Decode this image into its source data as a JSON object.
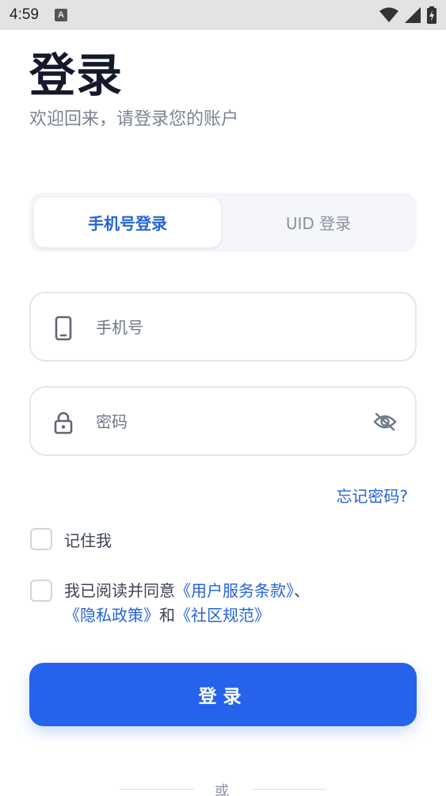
{
  "status_bar": {
    "time": "4:59",
    "notification_letter": "A"
  },
  "header": {
    "title": "登录",
    "subtitle": "欢迎回来，请登录您的账户"
  },
  "tabs": [
    {
      "label": "手机号登录",
      "active": true
    },
    {
      "label": "UID 登录",
      "active": false
    }
  ],
  "phone_field": {
    "placeholder": "手机号",
    "value": "",
    "icon": "phone-icon"
  },
  "password_field": {
    "placeholder": "密码",
    "value": "",
    "icon": "lock-icon",
    "toggle_icon": "eye-off-icon"
  },
  "forgot_password": "忘记密码?",
  "remember_me": {
    "label": "记住我",
    "checked": false
  },
  "agreement": {
    "checked": false,
    "prefix": "我已阅读并同意",
    "terms": "《用户服务条款》",
    "sep": "、",
    "privacy": "《隐私政策》",
    "and": "和",
    "community": "《社区规范》"
  },
  "login_button": "登录",
  "divider_text": "或",
  "colors": {
    "accent": "#2563eb",
    "link": "#2563d9",
    "title": "#141a2b",
    "muted": "#7b8392"
  }
}
